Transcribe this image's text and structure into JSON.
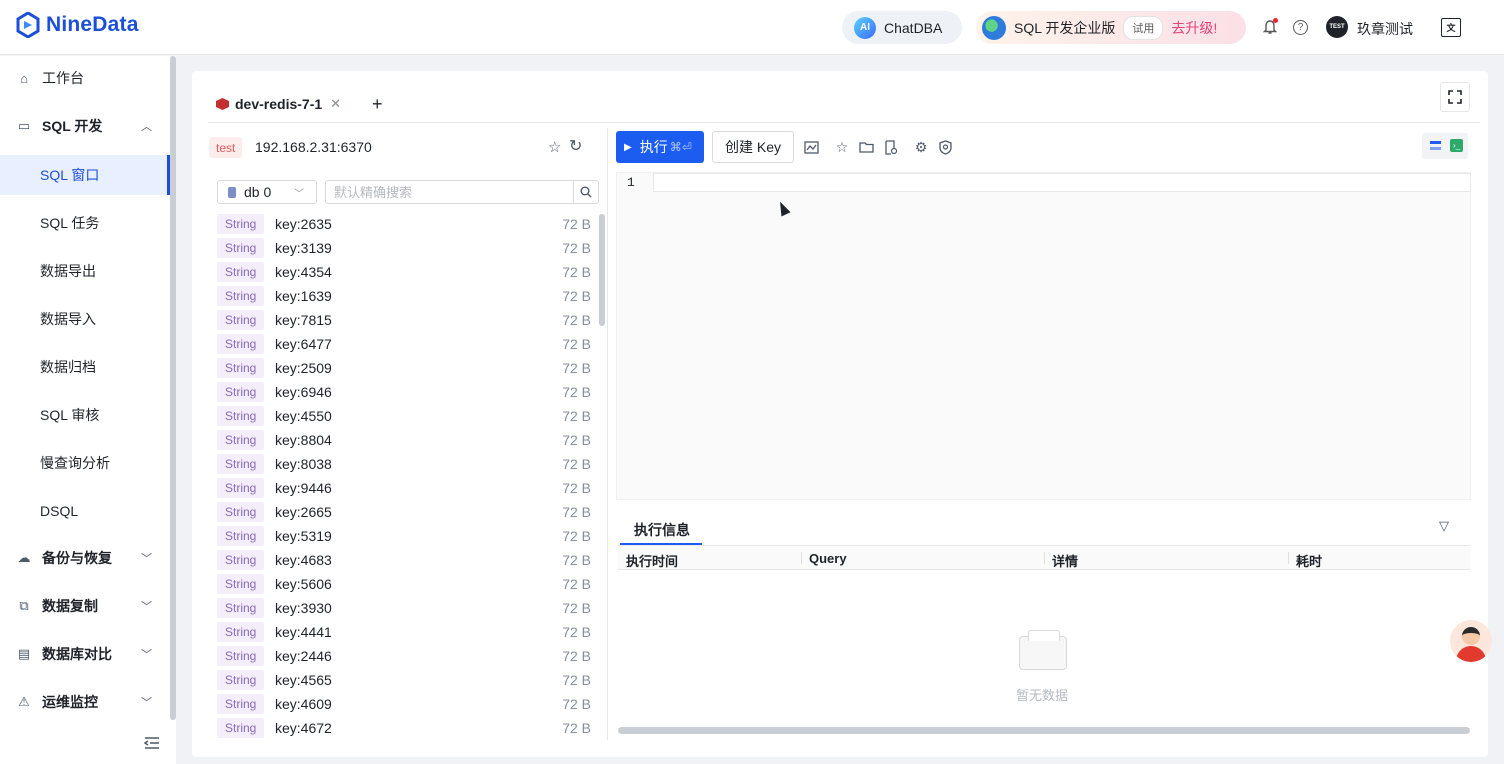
{
  "header": {
    "logo_text": "NineData",
    "chatdba_ai": "AI",
    "chatdba_label": "ChatDBA",
    "edition_label": "SQL 开发企业版",
    "trial_badge": "试用",
    "upgrade_label": "去升级!",
    "help_glyph": "?",
    "avatar_text": "TEST",
    "username": "玖章测试",
    "lang_glyph": "文"
  },
  "sidebar": {
    "items": [
      {
        "label": "工作台",
        "icon": "home-icon"
      },
      {
        "label": "SQL 开发",
        "icon": "monitor-icon",
        "expanded": true
      },
      {
        "label": "SQL 窗口",
        "active": true
      },
      {
        "label": "SQL 任务"
      },
      {
        "label": "数据导出"
      },
      {
        "label": "数据导入"
      },
      {
        "label": "数据归档"
      },
      {
        "label": "SQL 审核"
      },
      {
        "label": "慢查询分析"
      },
      {
        "label": "DSQL"
      },
      {
        "label": "备份与恢复",
        "icon": "cloud-icon"
      },
      {
        "label": "数据复制",
        "icon": "copy-icon"
      },
      {
        "label": "数据库对比",
        "icon": "compare-icon"
      },
      {
        "label": "运维监控",
        "icon": "alarm-icon"
      }
    ]
  },
  "tabs": [
    {
      "title": "dev-redis-7-1",
      "close": "✕"
    }
  ],
  "tab_add": "+",
  "connection": {
    "env_tag": "test",
    "host": "192.168.2.31:6370"
  },
  "db_select": {
    "value": "db 0"
  },
  "search": {
    "placeholder": "默认精确搜索"
  },
  "keys": [
    {
      "type": "String",
      "name": "key:2635",
      "size": "72 B"
    },
    {
      "type": "String",
      "name": "key:3139",
      "size": "72 B"
    },
    {
      "type": "String",
      "name": "key:4354",
      "size": "72 B"
    },
    {
      "type": "String",
      "name": "key:1639",
      "size": "72 B"
    },
    {
      "type": "String",
      "name": "key:7815",
      "size": "72 B"
    },
    {
      "type": "String",
      "name": "key:6477",
      "size": "72 B"
    },
    {
      "type": "String",
      "name": "key:2509",
      "size": "72 B"
    },
    {
      "type": "String",
      "name": "key:6946",
      "size": "72 B"
    },
    {
      "type": "String",
      "name": "key:4550",
      "size": "72 B"
    },
    {
      "type": "String",
      "name": "key:8804",
      "size": "72 B"
    },
    {
      "type": "String",
      "name": "key:8038",
      "size": "72 B"
    },
    {
      "type": "String",
      "name": "key:9446",
      "size": "72 B"
    },
    {
      "type": "String",
      "name": "key:2665",
      "size": "72 B"
    },
    {
      "type": "String",
      "name": "key:5319",
      "size": "72 B"
    },
    {
      "type": "String",
      "name": "key:4683",
      "size": "72 B"
    },
    {
      "type": "String",
      "name": "key:5606",
      "size": "72 B"
    },
    {
      "type": "String",
      "name": "key:3930",
      "size": "72 B"
    },
    {
      "type": "String",
      "name": "key:4441",
      "size": "72 B"
    },
    {
      "type": "String",
      "name": "key:2446",
      "size": "72 B"
    },
    {
      "type": "String",
      "name": "key:4565",
      "size": "72 B"
    },
    {
      "type": "String",
      "name": "key:4609",
      "size": "72 B"
    },
    {
      "type": "String",
      "name": "key:4672",
      "size": "72 B"
    }
  ],
  "toolbar": {
    "run_label": "执行",
    "run_shortcut": "⌘⏎",
    "create_key_label": "创建 Key"
  },
  "editor": {
    "line_number": "1"
  },
  "exec_info": {
    "tab_label": "执行信息",
    "columns": [
      "执行时间",
      "Query",
      "详情",
      "耗时"
    ],
    "empty_text": "暂无数据"
  },
  "colors": {
    "brand": "#1c4fd8",
    "primary_button": "#1c5cf0",
    "env_tag_text": "#e25a5a",
    "type_tag_text": "#8a68b8"
  }
}
